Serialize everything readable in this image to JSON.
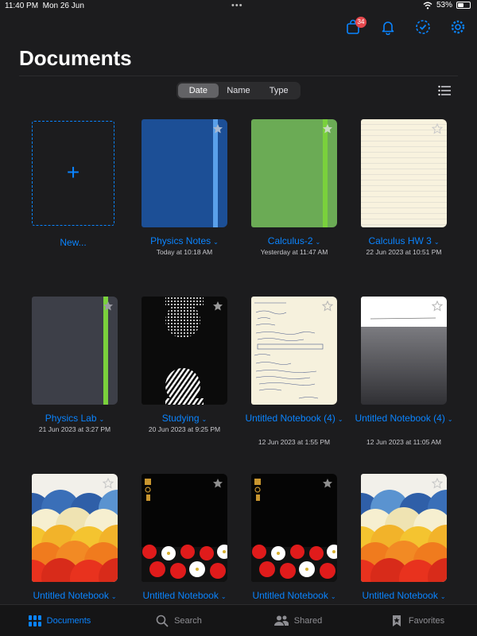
{
  "status": {
    "time": "11:40 PM",
    "date": "Mon 26 Jun",
    "battery": "53%",
    "battery_level": 0.53
  },
  "header": {
    "badge_count": "34",
    "title": "Documents"
  },
  "sort": {
    "options": [
      "Date",
      "Name",
      "Type"
    ],
    "selected": "Date"
  },
  "new_item": {
    "label": "New..."
  },
  "documents": [
    {
      "name": "Physics Notes",
      "date": "Today at 10:18 AM",
      "cover": "blue"
    },
    {
      "name": "Calculus-2",
      "date": "Yesterday at 11:47 AM",
      "cover": "green"
    },
    {
      "name": "Calculus HW 3",
      "date": "22 Jun 2023 at 10:51 PM",
      "cover": "paper"
    },
    {
      "name": "Physics Lab",
      "date": "21 Jun 2023 at 3:27 PM",
      "cover": "gray"
    },
    {
      "name": "Studying",
      "date": "20 Jun 2023 at 9:25 PM",
      "cover": "dots"
    },
    {
      "name": "Untitled Notebook (4)",
      "date": "12 Jun 2023 at 1:55 PM",
      "cover": "handwritten"
    },
    {
      "name": "Untitled Notebook (4)",
      "date": "12 Jun 2023 at 11:05 AM",
      "cover": "gradient"
    },
    {
      "name": "Untitled Notebook",
      "date": "",
      "cover": "waves"
    },
    {
      "name": "Untitled Notebook",
      "date": "",
      "cover": "flowers"
    },
    {
      "name": "Untitled Notebook",
      "date": "",
      "cover": "flowers"
    },
    {
      "name": "Untitled Notebook",
      "date": "",
      "cover": "waves"
    }
  ],
  "tabs": [
    {
      "label": "Documents",
      "icon": "grid-icon",
      "active": true
    },
    {
      "label": "Search",
      "icon": "search-icon",
      "active": false
    },
    {
      "label": "Shared",
      "icon": "people-icon",
      "active": false
    },
    {
      "label": "Favorites",
      "icon": "star-bookmark-icon",
      "active": false
    }
  ],
  "colors": {
    "accent": "#0a84ff",
    "background": "#1c1c1e",
    "badge": "#e5484d"
  }
}
